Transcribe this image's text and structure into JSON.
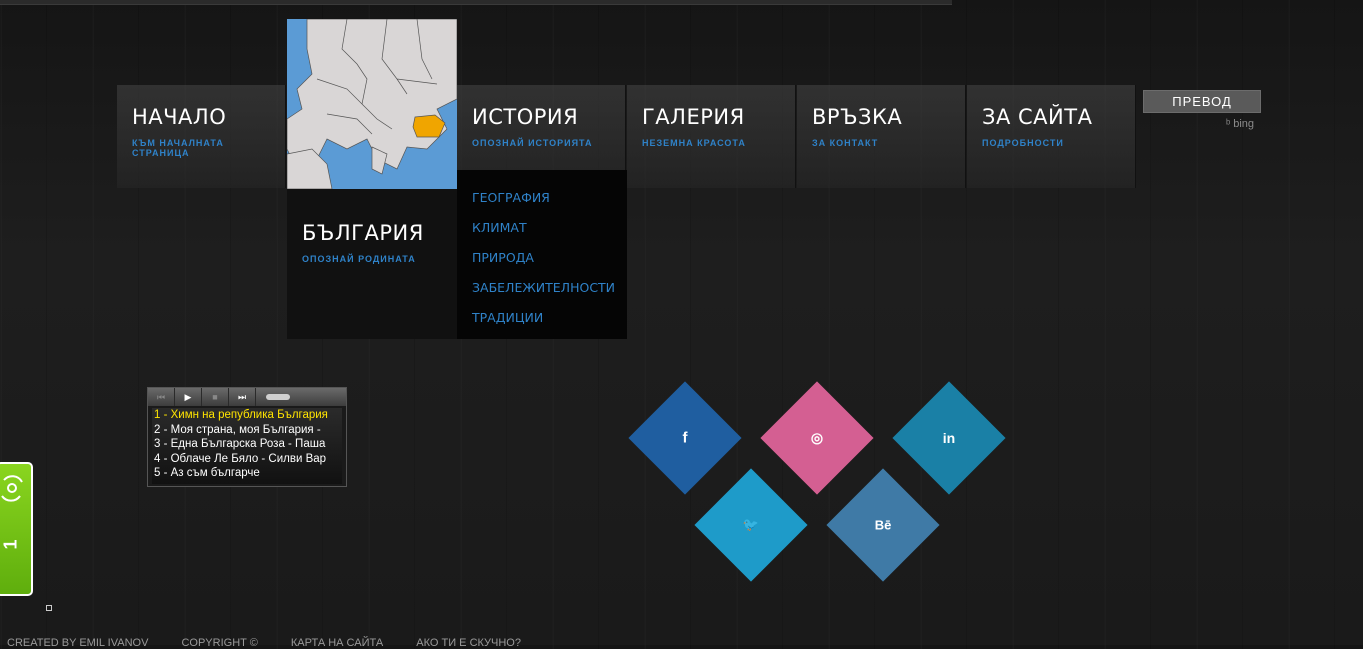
{
  "nav": {
    "home": {
      "title": "НАЧАЛО",
      "sub": "КЪМ НАЧАЛНАТА СТРАНИЦА"
    },
    "bulgaria": {
      "title": "БЪЛГАРИЯ",
      "sub": "ОПОЗНАЙ РОДИНАТА"
    },
    "history": {
      "title": "ИСТОРИЯ",
      "sub": "ОПОЗНАЙ ИСТОРИЯТА"
    },
    "gallery": {
      "title": "ГАЛЕРИЯ",
      "sub": "НЕЗЕМНА КРАСОТА"
    },
    "contact": {
      "title": "ВРЪЗКА",
      "sub": "ЗА КОНТАКТ"
    },
    "about": {
      "title": "ЗА САЙТА",
      "sub": "ПОДРОБНОСТИ"
    }
  },
  "submenu": [
    "ГЕОГРАФИЯ",
    "КЛИМАТ",
    "ПРИРОДА",
    "ЗАБЕЛЕЖИТЕЛНОСТИ",
    "ТРАДИЦИИ"
  ],
  "translate": {
    "label": "ПРЕВОД",
    "provider": "bing"
  },
  "player": {
    "tracks": [
      "1 - Химн на република България",
      "2 - Моя страна, моя България - ",
      "3 - Една Българска Роза - Паша",
      "4 - Облаче Ле Бяло - Силви Вар",
      "5 - Аз съм българче"
    ]
  },
  "social": [
    {
      "name": "facebook",
      "glyph": "f",
      "color": "#1f5ea0"
    },
    {
      "name": "dribbble",
      "glyph": "◎",
      "color": "#d45f92"
    },
    {
      "name": "linkedin",
      "glyph": "in",
      "color": "#1a80a6"
    },
    {
      "name": "twitter",
      "glyph": "🐦",
      "color": "#1e9bc9"
    },
    {
      "name": "behance",
      "glyph": "Bē",
      "color": "#3f7aa6"
    }
  ],
  "widget": {
    "label": "1"
  },
  "footer": [
    "CREATED BY EMIL IVANOV",
    "COPYRIGHT ©",
    "КАРТА НА САЙТА",
    "АКО ТИ Е СКУЧНО?"
  ],
  "colors": {
    "accent": "#2f82c8",
    "map_sea": "#5b9bd5",
    "map_land": "#d9d6d6",
    "map_highlight": "#f0a500"
  }
}
